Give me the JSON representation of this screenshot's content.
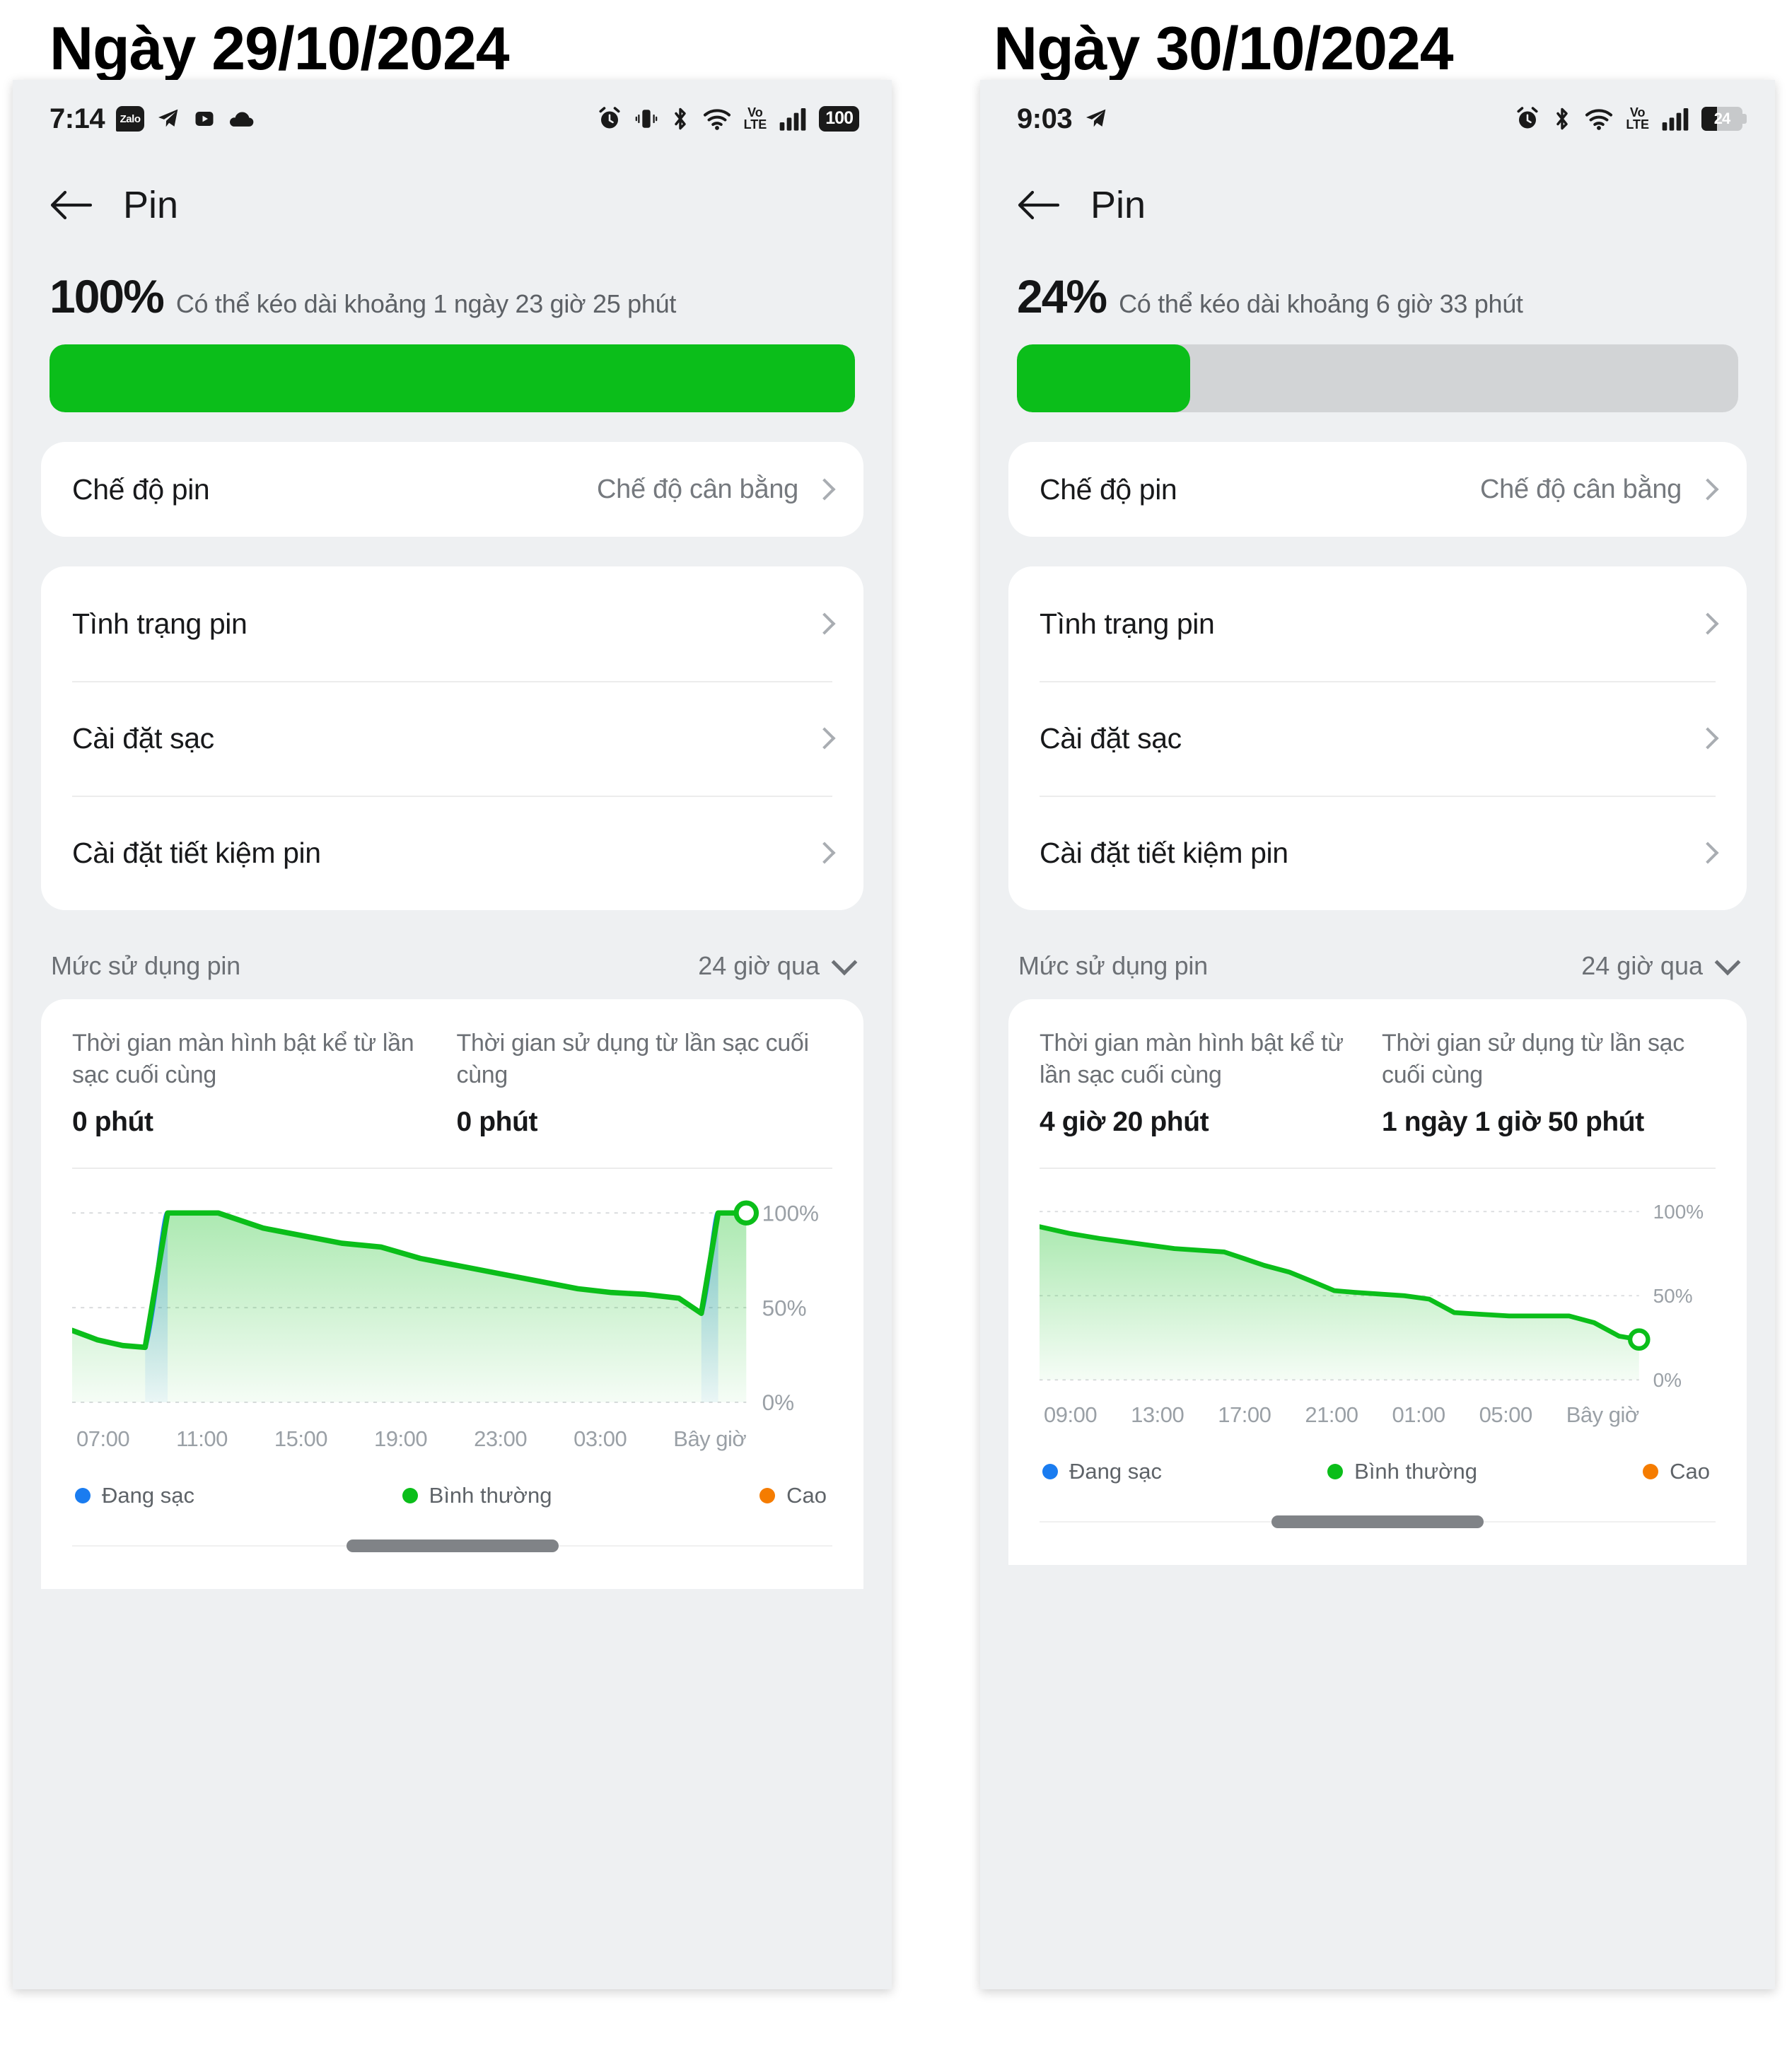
{
  "captions": {
    "left": "Ngày 29/10/2024",
    "right": "Ngày 30/10/2024"
  },
  "colors": {
    "green": "#0BBE1A",
    "blue": "#1A7CF0",
    "orange": "#F57C00",
    "track": "#D2D4D6",
    "background": "#EEF0F2"
  },
  "panels": [
    {
      "id": "left",
      "status": {
        "clock": "7:14",
        "left_icons": [
          "zalo-icon",
          "telegram-icon",
          "youtube-icon",
          "cloud-icon"
        ],
        "right_icons": [
          "alarm-icon",
          "vibrate-icon",
          "bluetooth-icon",
          "wifi-icon",
          "volte-icon",
          "signal-icon"
        ],
        "volte_top": "Vo",
        "volte_bottom": "LTE",
        "battery_level": "100",
        "battery_style": "pill"
      },
      "header": {
        "back": "back-arrow-icon",
        "title": "Pin"
      },
      "summary": {
        "percent": "100%",
        "percent_value": 100,
        "description": "Có thể kéo dài khoảng 1 ngày 23 giờ 25 phút"
      },
      "mode_row": {
        "label": "Chế độ pin",
        "value": "Chế độ cân bằng"
      },
      "menu": [
        {
          "label": "Tình trạng pin"
        },
        {
          "label": "Cài đặt sạc"
        },
        {
          "label": "Cài đặt tiết kiệm pin"
        }
      ],
      "usage": {
        "title": "Mức sử dụng pin",
        "range": "24 giờ qua",
        "stats": [
          {
            "key": "Thời gian màn hình bật kể từ lần sạc cuối cùng",
            "value": "0 phút"
          },
          {
            "key": "Thời gian sử dụng từ lần sạc cuối cùng",
            "value": "0 phút"
          }
        ]
      },
      "legend": [
        {
          "label": "Đang sạc",
          "color": "#1A7CF0"
        },
        {
          "label": "Bình thường",
          "color": "#0BBE1A"
        },
        {
          "label": "Cao",
          "color": "#F57C00"
        }
      ]
    },
    {
      "id": "right",
      "status": {
        "clock": "9:03",
        "left_icons": [
          "telegram-icon"
        ],
        "right_icons": [
          "alarm-icon",
          "bluetooth-icon",
          "wifi-icon",
          "volte-icon",
          "signal-icon"
        ],
        "volte_top": "Vo",
        "volte_bottom": "LTE",
        "battery_level": "24",
        "battery_style": "shell"
      },
      "header": {
        "back": "back-arrow-icon",
        "title": "Pin"
      },
      "summary": {
        "percent": "24%",
        "percent_value": 24,
        "description": "Có thể kéo dài khoảng 6 giờ 33 phút"
      },
      "mode_row": {
        "label": "Chế độ pin",
        "value": "Chế độ cân bằng"
      },
      "menu": [
        {
          "label": "Tình trạng pin"
        },
        {
          "label": "Cài đặt sạc"
        },
        {
          "label": "Cài đặt tiết kiệm pin"
        }
      ],
      "usage": {
        "title": "Mức sử dụng pin",
        "range": "24 giờ qua",
        "stats": [
          {
            "key": "Thời gian màn hình bật kể từ lần sạc cuối cùng",
            "value": "4 giờ 20 phút"
          },
          {
            "key": "Thời gian sử dụng từ lần sạc cuối cùng",
            "value": "1 ngày 1 giờ 50 phút"
          }
        ]
      },
      "legend": [
        {
          "label": "Đang sạc",
          "color": "#1A7CF0"
        },
        {
          "label": "Bình thường",
          "color": "#0BBE1A"
        },
        {
          "label": "Cao",
          "color": "#F57C00"
        }
      ]
    }
  ],
  "chart_data": [
    {
      "type": "area",
      "title": "Mức sử dụng pin — 29/10/2024",
      "ylabel": "%",
      "ylim": [
        0,
        100
      ],
      "ytick_labels": [
        "100%",
        "50%",
        "0%"
      ],
      "yticks": [
        100,
        50,
        0
      ],
      "grid": true,
      "legend_position": "bottom",
      "xtick_labels": [
        "07:00",
        "11:00",
        "15:00",
        "19:00",
        "23:00",
        "03:00",
        "Bây giờ"
      ],
      "series": [
        {
          "name": "Bình thường",
          "color": "#0BBE1A",
          "x": [
            0.0,
            0.9,
            1.8,
            2.6,
            3.4,
            5.2,
            6.8,
            8.2,
            9.6,
            11.0,
            12.4,
            13.8,
            15.2,
            16.6,
            18.0,
            19.2,
            20.4,
            21.6,
            22.4,
            23.0,
            24.0
          ],
          "y": [
            38,
            33,
            30,
            29,
            100,
            100,
            92,
            88,
            84,
            82,
            76,
            72,
            68,
            64,
            60,
            58,
            57,
            55,
            47,
            100,
            100
          ]
        },
        {
          "name": "Đang sạc",
          "color": "#1A7CF0",
          "segments": [
            {
              "x_start": 2.6,
              "x_end": 3.4,
              "y_start": 29,
              "y_end": 100
            },
            {
              "x_start": 22.4,
              "x_end": 23.0,
              "y_start": 47,
              "y_end": 100
            }
          ]
        }
      ],
      "end_marker": {
        "x": 24.0,
        "y": 100,
        "color": "#0BBE1A"
      }
    },
    {
      "type": "area",
      "title": "Mức sử dụng pin — 30/10/2024",
      "ylabel": "%",
      "ylim": [
        0,
        100
      ],
      "ytick_labels": [
        "100%",
        "50%",
        "0%"
      ],
      "yticks": [
        100,
        50,
        0
      ],
      "grid": true,
      "legend_position": "bottom",
      "xtick_labels": [
        "09:00",
        "13:00",
        "17:00",
        "21:00",
        "01:00",
        "05:00",
        "Bây giờ"
      ],
      "series": [
        {
          "name": "Bình thường",
          "color": "#0BBE1A",
          "x": [
            0.0,
            1.2,
            2.4,
            3.4,
            4.4,
            5.4,
            6.4,
            7.4,
            8.2,
            9.0,
            10.0,
            11.0,
            11.8,
            12.6,
            13.6,
            14.6,
            15.6,
            16.6,
            17.6,
            18.8,
            20.0,
            21.2,
            22.2,
            23.2,
            24.0
          ],
          "y": [
            91,
            87,
            84,
            82,
            80,
            78,
            77,
            76,
            72,
            68,
            64,
            58,
            53,
            52,
            51,
            50,
            48,
            40,
            39,
            38,
            38,
            38,
            34,
            26,
            24
          ]
        }
      ],
      "end_marker": {
        "x": 24.0,
        "y": 24,
        "color": "#0BBE1A"
      }
    }
  ]
}
